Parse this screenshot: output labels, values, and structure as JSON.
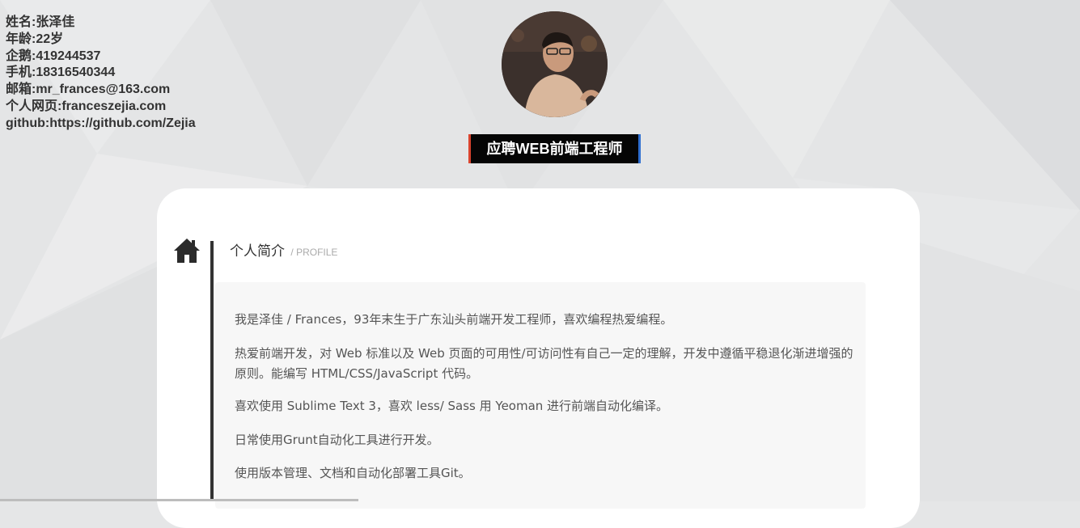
{
  "contact": {
    "name": "姓名:张泽佳",
    "age": "年龄:22岁",
    "qq": "企鹅:419244537",
    "phone": "手机:18316540344",
    "email": "邮箱:mr_frances@163.com",
    "homepage": "个人网页:franceszejia.com",
    "github": "github:https://github.com/Zejia"
  },
  "header": {
    "job_title": "应聘WEB前端工程师"
  },
  "profile": {
    "icon": "home-icon",
    "title": "个人简介",
    "subtitle": "/ PROFILE",
    "paragraphs": [
      "我是泽佳 / Frances，93年末生于广东汕头前端开发工程师，喜欢编程热爱编程。",
      "热爱前端开发，对 Web 标准以及 Web 页面的可用性/可访问性有自己一定的理解，开发中遵循平稳退化渐进增强的原则。能编写 HTML/CSS/JavaScript 代码。",
      "喜欢使用 Sublime Text 3，喜欢 less/ Sass 用 Yeoman 进行前端自动化编译。",
      "日常使用Grunt自动化工具进行开发。",
      "使用版本管理、文档和自动化部署工具Git。"
    ]
  },
  "colors": {
    "title_bar_bg": "#050505",
    "title_bar_left_accent": "#d9442e",
    "title_bar_right_accent": "#2f6fd0",
    "timeline": "#333333"
  }
}
